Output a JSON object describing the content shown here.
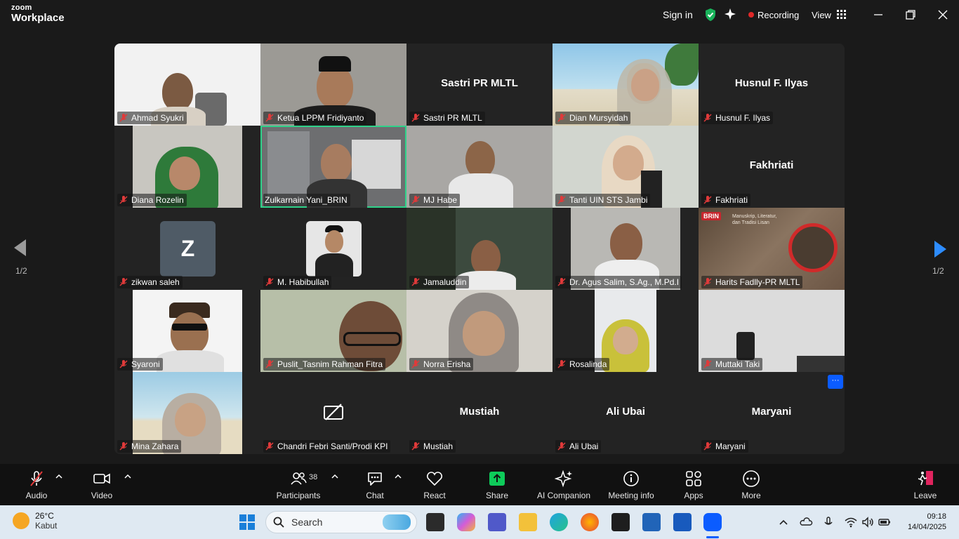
{
  "app": {
    "logo_top": "zoom",
    "logo_bottom": "Workplace"
  },
  "titlebar": {
    "sign_in": "Sign in",
    "recording": "Recording",
    "view": "View"
  },
  "paging": {
    "left_label": "1/2",
    "right_label": "1/2"
  },
  "participants": [
    {
      "name": "Ahmad Syukri",
      "video": true
    },
    {
      "name": "Ketua LPPM Fridiyanto",
      "video": true
    },
    {
      "name": "Sastri PR MLTL",
      "video": false
    },
    {
      "name": "Dian Mursyidah",
      "video": true
    },
    {
      "name": "Husnul F. Ilyas",
      "video": false
    },
    {
      "name": "Diana Rozelin",
      "video": true
    },
    {
      "name": "Zulkarnain Yani_BRIN",
      "video": true,
      "active_speaker": true
    },
    {
      "name": "MJ Habe",
      "video": true
    },
    {
      "name": "Tanti UIN STS Jambi",
      "video": true
    },
    {
      "name": "Fakhriati",
      "video": false
    },
    {
      "name": "zikwan saleh",
      "video": false,
      "avatar_letter": "Z"
    },
    {
      "name": "M. Habibullah",
      "video": false,
      "profile_photo": true
    },
    {
      "name": "Jamaluddin",
      "video": true
    },
    {
      "name": "Dr. Agus Salim, S.Ag., M.Pd.I",
      "video": true
    },
    {
      "name": "Harits Fadlly-PR MLTL",
      "video": true,
      "brand_text": "BRIN",
      "banner_text": "Manuskrip, Literatur, dan Tradisi Lisan"
    },
    {
      "name": "Syaroni",
      "video": true
    },
    {
      "name": "Puslit_Tasnim Rahman Fitra",
      "video": true
    },
    {
      "name": "Norra Erisha",
      "video": true
    },
    {
      "name": "Rosalinda",
      "video": true
    },
    {
      "name": "Muttaki Taki",
      "video": true
    },
    {
      "name": "Mina Zahara",
      "video": true
    },
    {
      "name": "Chandri Febri Santi/Prodi KPI",
      "video": false,
      "camera_off_icon": true
    },
    {
      "name": "Mustiah",
      "video": false
    },
    {
      "name": "Ali Ubai",
      "video": false
    },
    {
      "name": "Maryani",
      "video": false
    }
  ],
  "toolbar": {
    "audio": "Audio",
    "video": "Video",
    "participants": "Participants",
    "participants_count": "38",
    "chat": "Chat",
    "react": "React",
    "share": "Share",
    "ai_companion": "AI Companion",
    "meeting_info": "Meeting info",
    "apps": "Apps",
    "more": "More",
    "leave": "Leave"
  },
  "taskbar": {
    "temperature": "26°C",
    "weather": "Kabut",
    "search_placeholder": "Search",
    "time": "09:18",
    "date": "14/04/2025"
  },
  "colors": {
    "active_speaker": "#2fd28a",
    "share": "#0ecb5a",
    "recording": "#e02828",
    "accent": "#0b5cff"
  }
}
